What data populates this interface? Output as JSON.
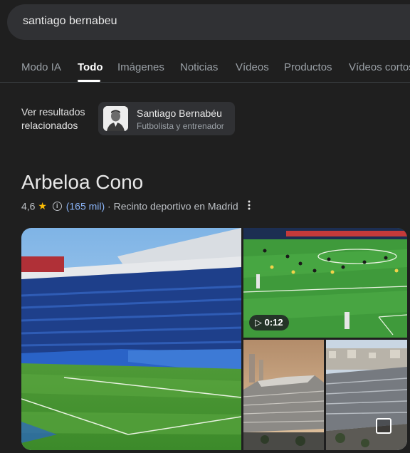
{
  "search": {
    "query": "santiago bernabeu"
  },
  "tabs": [
    {
      "label": "Modo IA"
    },
    {
      "label": "Todo"
    },
    {
      "label": "Imágenes"
    },
    {
      "label": "Noticias"
    },
    {
      "label": "Vídeos"
    },
    {
      "label": "Productos"
    },
    {
      "label": "Vídeos cortos"
    }
  ],
  "related": {
    "label": "Ver resultados relacionados",
    "chip_name": "Santiago Bernabéu",
    "chip_subtitle": "Futbolista y entrenador"
  },
  "place": {
    "title": "Arbeloa Cono",
    "rating": "4,6",
    "reviews": "(165 mil)",
    "separator": " · ",
    "category": "Recinto deportivo en Madrid"
  },
  "gallery": {
    "video_duration": "0:12"
  },
  "colors": {
    "background": "#1f1f1f",
    "link": "#8ab4f8",
    "star": "#fbbc04"
  }
}
